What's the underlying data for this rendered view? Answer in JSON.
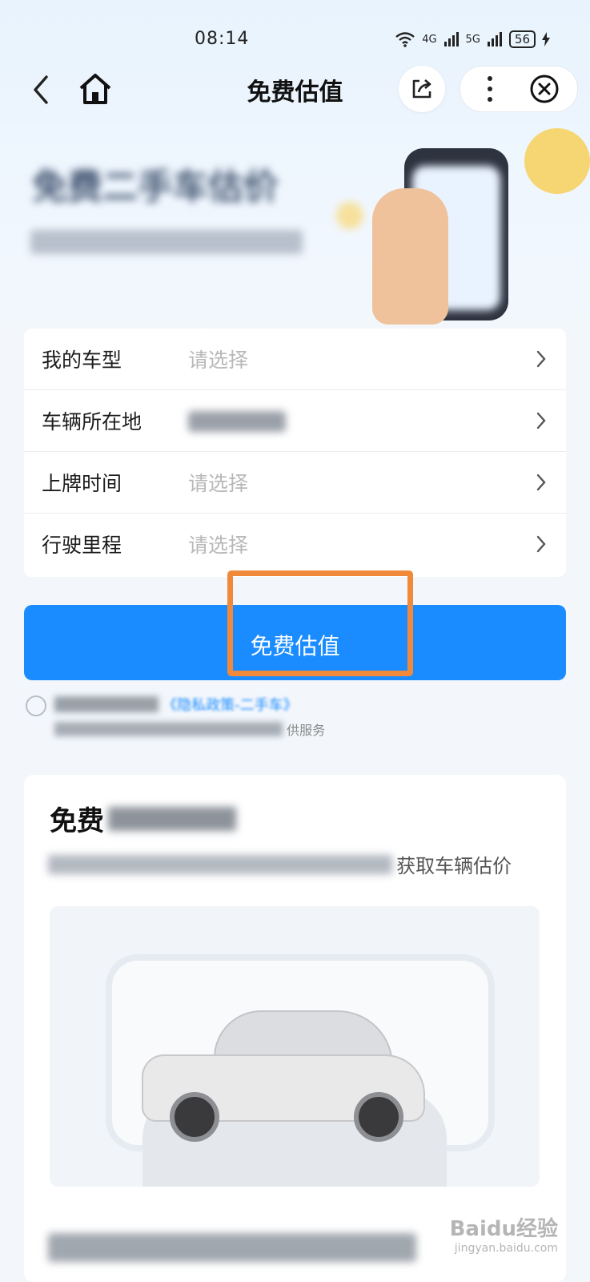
{
  "status_bar": {
    "time": "08:14",
    "network_1": "4G",
    "network_2": "5G",
    "battery": "56"
  },
  "header": {
    "title": "免费估值",
    "back_icon": "chevron-left-icon",
    "home_icon": "home-icon",
    "share_icon": "share-icon",
    "more_icon": "more-vertical-icon",
    "close_icon": "close-circle-icon"
  },
  "hero": {
    "title": "免费二手车估价",
    "subtitle": ""
  },
  "form": {
    "rows": [
      {
        "label": "我的车型",
        "value": "请选择"
      },
      {
        "label": "车辆所在地",
        "value": ""
      },
      {
        "label": "上牌时间",
        "value": "请选择"
      },
      {
        "label": "行驶里程",
        "value": "请选择"
      }
    ]
  },
  "cta": {
    "label": "免费估值",
    "color": "#1a8cff"
  },
  "highlight_color": "#f08a3a",
  "agreement": {
    "line1": "《隐私政策-二手车》",
    "line2": "供服务"
  },
  "card": {
    "title": "免费",
    "description": "获取车辆估价"
  },
  "watermark": {
    "brand": "Baidu经验",
    "url": "jingyan.baidu.com"
  }
}
